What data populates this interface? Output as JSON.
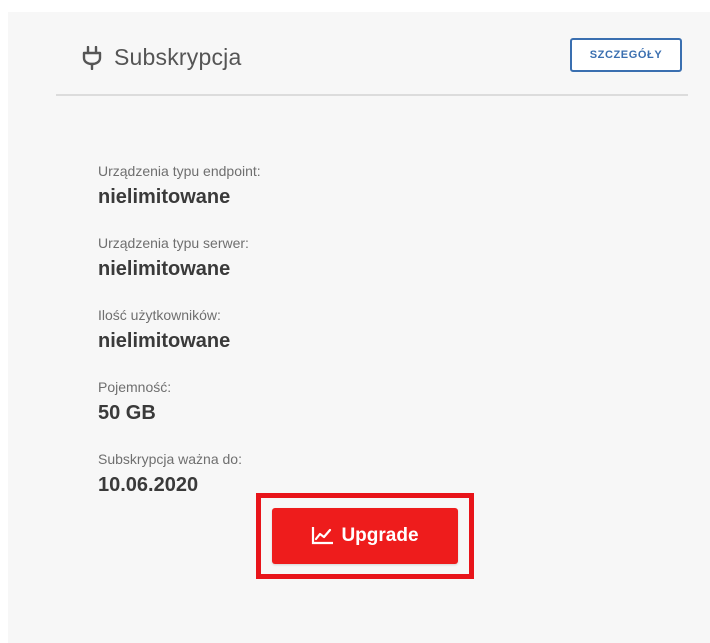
{
  "header": {
    "title": "Subskrypcja",
    "details_label": "SZCZEGÓŁY"
  },
  "subscription": {
    "items": [
      {
        "label": "Urządzenia typu endpoint:",
        "value": "nielimitowane"
      },
      {
        "label": "Urządzenia typu serwer:",
        "value": "nielimitowane"
      },
      {
        "label": "Ilość użytkowników:",
        "value": "nielimitowane"
      },
      {
        "label": "Pojemność:",
        "value": "50 GB"
      },
      {
        "label": "Subskrypcja ważna do:",
        "value": "10.06.2020"
      }
    ]
  },
  "upgrade": {
    "label": "Upgrade",
    "icon": "chart-line-icon"
  },
  "colors": {
    "accent_blue": "#3a6fb0",
    "upgrade_red": "#ee1c1c",
    "highlight_red": "#e8141a"
  }
}
